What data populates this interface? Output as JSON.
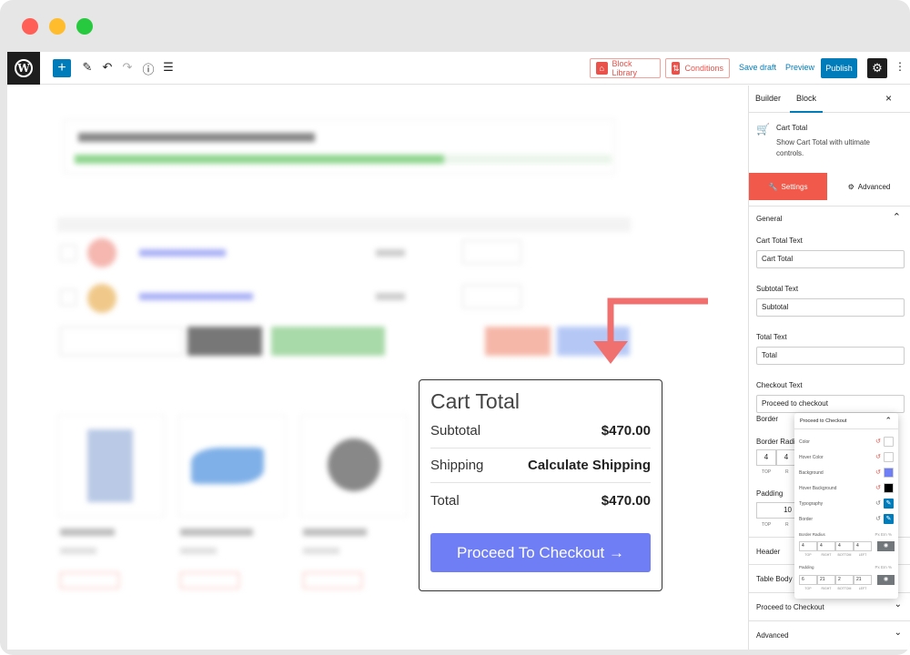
{
  "window_controls": {
    "colors": [
      "#ff5f56",
      "#ffbd2e",
      "#27c93f"
    ]
  },
  "toolbar": {
    "logo": "wordpress-logo",
    "logo_letter": "W",
    "add_icon": "+",
    "buttons": {
      "block_library": "Block Library",
      "conditions": "Conditions"
    },
    "save_draft": "Save draft",
    "preview": "Preview",
    "publish": "Publish"
  },
  "cart_total": {
    "title": "Cart Total",
    "rows": [
      {
        "label": "Subtotal",
        "value": "$470.00"
      },
      {
        "label": "Shipping",
        "value": "Calculate Shipping"
      },
      {
        "label": "Total",
        "value": "$470.00"
      }
    ],
    "checkout_label": "Proceed To Checkout →",
    "button_color": "#6f7ef5"
  },
  "sidebar": {
    "tabs": [
      "Builder",
      "Block"
    ],
    "active_tab": "Block",
    "close": "×",
    "block": {
      "name": "Cart Total",
      "description": "Show Cart Total with ultimate controls."
    },
    "panel_tabs": {
      "settings": "Settings",
      "advanced": "Advanced"
    },
    "accent": "#f15a4a",
    "general_title": "General",
    "fields": [
      {
        "label": "Cart Total Text",
        "value": "Cart Total"
      },
      {
        "label": "Subtotal Text",
        "value": "Subtotal"
      },
      {
        "label": "Total Text",
        "value": "Total"
      },
      {
        "label": "Checkout Text",
        "value": "Proceed to checkout"
      }
    ],
    "border_label": "Border",
    "border_radius_label": "Border Radiu",
    "border_radius_values": [
      "4",
      "4"
    ],
    "border_radius_sub": [
      "TOP",
      "R"
    ],
    "padding_label": "Padding",
    "padding_value": "10",
    "padding_sub": [
      "TOP",
      "R"
    ],
    "accordions": [
      "Header",
      "Table Body",
      "Proceed to Checkout",
      "Advanced"
    ]
  },
  "popover": {
    "title": "Proceed to Checkout",
    "rows": [
      {
        "label": "Color",
        "type": "swatch",
        "color": "#ffffff"
      },
      {
        "label": "Hover Color",
        "type": "swatch",
        "color": "#ffffff"
      },
      {
        "label": "Background",
        "type": "swatch",
        "color": "#6f7ef5"
      },
      {
        "label": "Hover Background",
        "type": "swatch",
        "color": "#000000"
      },
      {
        "label": "Typography",
        "type": "edit"
      },
      {
        "label": "Border",
        "type": "edit"
      }
    ],
    "border_radius": {
      "label": "Border Radius",
      "units": "Px  Em  %",
      "values": [
        "4",
        "4",
        "4",
        "4"
      ],
      "sub": [
        "TOP",
        "RIGHT",
        "BOTTOM",
        "LEFT"
      ]
    },
    "padding": {
      "label": "Padding",
      "units": "Px  Em  %",
      "values": [
        "6",
        "21",
        "2",
        "21"
      ],
      "sub": [
        "TOP",
        "RIGHT",
        "BOTTOM",
        "LEFT"
      ]
    }
  }
}
